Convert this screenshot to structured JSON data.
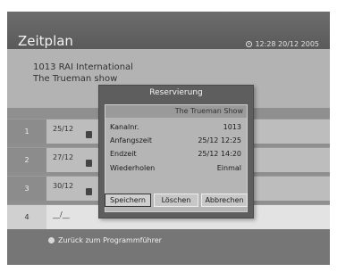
{
  "header": {
    "title": "Zeitplan",
    "clock_icon": "clock-icon",
    "datetime": "12:28 20/12 2005"
  },
  "info": {
    "channel": "1013 RAI International",
    "program": "The Trueman show"
  },
  "schedule": [
    {
      "num": "1",
      "date": "25/12"
    },
    {
      "num": "2",
      "date": "27/12"
    },
    {
      "num": "3",
      "date": "30/12"
    },
    {
      "num": "4",
      "date": "__/__"
    }
  ],
  "dialog": {
    "title": "Reservierung",
    "program": "The Trueman Show",
    "fields": [
      {
        "label": "Kanalnr.",
        "value": "1013"
      },
      {
        "label": "Anfangszeit",
        "value": "25/12 12:25"
      },
      {
        "label": "Endzeit",
        "value": "25/12 14:20"
      },
      {
        "label": "Wiederholen",
        "value": "Einmal"
      }
    ],
    "buttons": {
      "save": "Speichern",
      "delete": "Löschen",
      "cancel": "Abbrechen"
    }
  },
  "footer": {
    "back_label": "Zurück zum Programmführer",
    "back_icon": "remote-button-icon"
  }
}
